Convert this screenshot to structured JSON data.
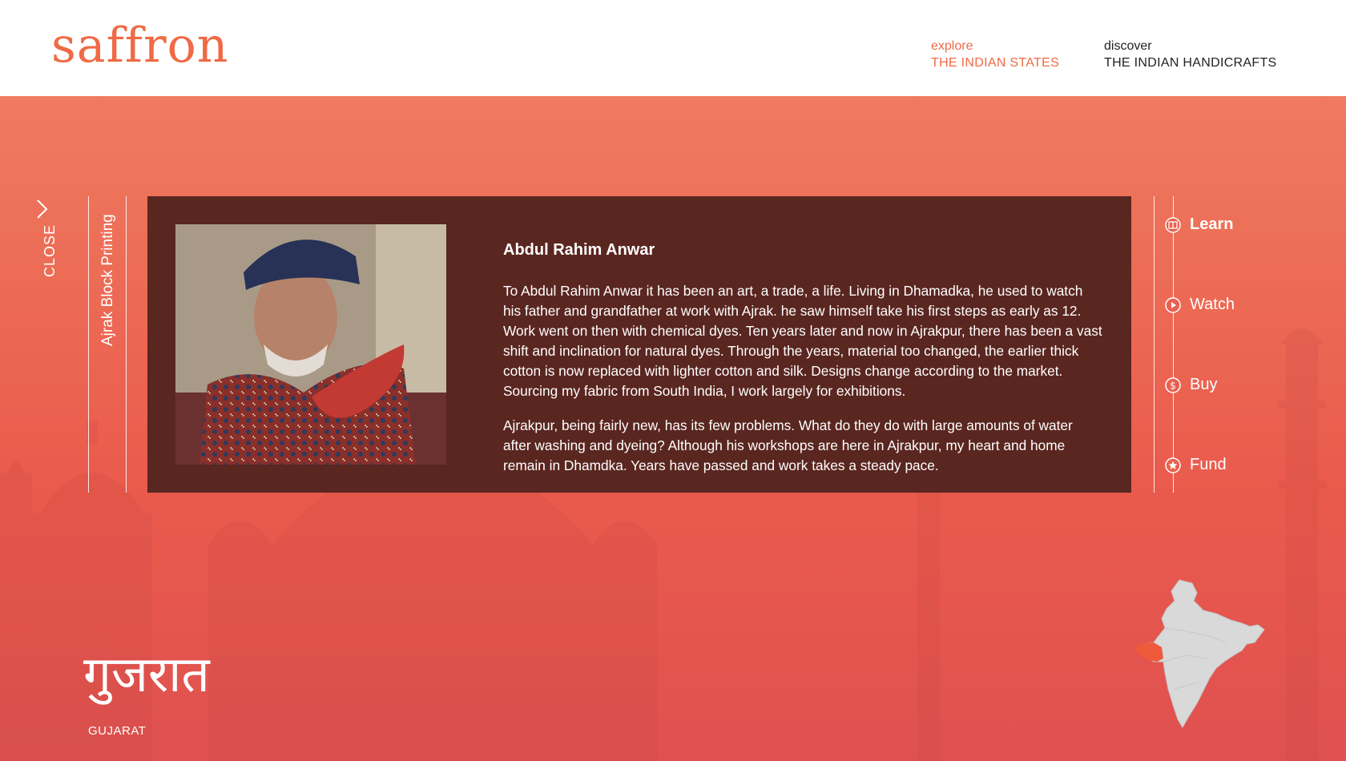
{
  "header": {
    "logo": "saffron",
    "nav": [
      {
        "small": "explore",
        "big": "THE INDIAN STATES",
        "active": true
      },
      {
        "small": "discover",
        "big": "THE INDIAN HANDICRAFTS",
        "active": false
      }
    ]
  },
  "close_label": "CLOSE",
  "craft_title": "Ajrak Block Printing",
  "artisan": {
    "name": "Abdul Rahim Anwar",
    "paragraphs": [
      "To Abdul Rahim Anwar it has been an art, a trade, a life. Living in Dhamadka, he used to watch his father and grandfather at work with Ajrak. he saw himself take his first steps as early as 12. Work went on then with chemical dyes. Ten years later and now in Ajrakpur, there has been a vast shift and inclination for natural dyes. Through the years, material too changed, the earlier thick cotton is now replaced with lighter cotton and silk. Designs change according to the market. Sourcing my fabric from South India, I work largely for exhibitions.",
      "Ajrakpur, being fairly new, has its few problems. What do they do with large amounts of water after washing and dyeing? Although his workshops are here in Ajrakpur, my heart and home remain in Dhamdka. Years have passed and work takes a steady pace."
    ]
  },
  "side_nav": [
    {
      "label": "Learn",
      "icon": "book-icon",
      "active": true
    },
    {
      "label": "Watch",
      "icon": "play-icon",
      "active": false
    },
    {
      "label": "Buy",
      "icon": "dollar-icon",
      "active": false
    },
    {
      "label": "Fund",
      "icon": "star-icon",
      "active": false
    }
  ],
  "state": {
    "name_devanagari": "गुजरात",
    "name": "GUJARAT"
  },
  "colors": {
    "accent": "#ef6a45",
    "card_bg": "#5a2620",
    "hero_top": "#ef7b60",
    "hero_bottom": "#df5150",
    "map_land": "#d9d9d9",
    "map_highlight": "#ef5a3c"
  }
}
